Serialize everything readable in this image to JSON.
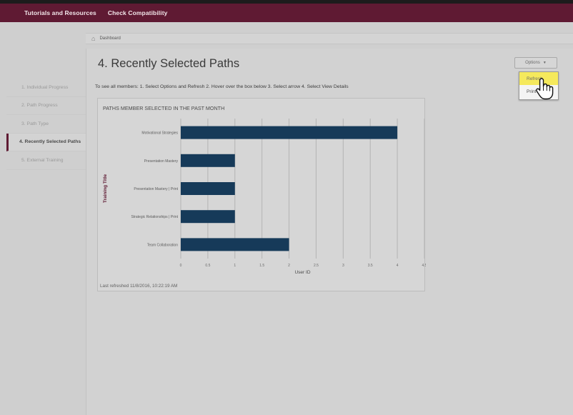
{
  "topnav": {
    "items": [
      "Tutorials and Resources",
      "Check Compatibility"
    ]
  },
  "breadcrumb": {
    "home_icon": "home-icon",
    "label": "Dashboard"
  },
  "sidebar": {
    "items": [
      {
        "label": "1. Individual Progress",
        "active": false
      },
      {
        "label": "2. Path Progress",
        "active": false
      },
      {
        "label": "3. Path Type",
        "active": false
      },
      {
        "label": "4. Recently Selected Paths",
        "active": true
      },
      {
        "label": "5. External Training",
        "active": false
      }
    ]
  },
  "main": {
    "title": "4. Recently Selected Paths",
    "instructions": "To see all members: 1. Select Options and Refresh 2. Hover over the box below 3. Select arrow 4. Select View Details"
  },
  "options": {
    "label": "Options",
    "caret_icon": "caret-down-icon",
    "menu": [
      {
        "label": "Refresh",
        "highlighted": true
      },
      {
        "label": "Print",
        "highlighted": false
      }
    ]
  },
  "panel": {
    "title": "PATHS MEMBER SELECTED IN THE PAST MONTH",
    "footer": "Last refreshed 11/8/2016, 10:22:19 AM"
  },
  "chart_data": {
    "type": "bar",
    "orientation": "horizontal",
    "categories": [
      "Motivational Strategies",
      "Presentation Mastery",
      "Presentation Mastery | Print",
      "Strategic Relationships | Print",
      "Team Collaboration"
    ],
    "values": [
      4,
      1,
      1,
      1,
      2
    ],
    "xlabel": "User ID",
    "ylabel": "Training Title",
    "xlim": [
      0,
      4.5
    ],
    "xticks": [
      "0",
      "0.5",
      "1",
      "1.5",
      "2",
      "2.5",
      "3",
      "3.5",
      "4",
      "4.5"
    ],
    "grid": true,
    "bar_color": "#163a59"
  },
  "colors": {
    "topbar": "#5f1a33",
    "accent": "#5f1a33",
    "highlight": "#f5e95c"
  }
}
